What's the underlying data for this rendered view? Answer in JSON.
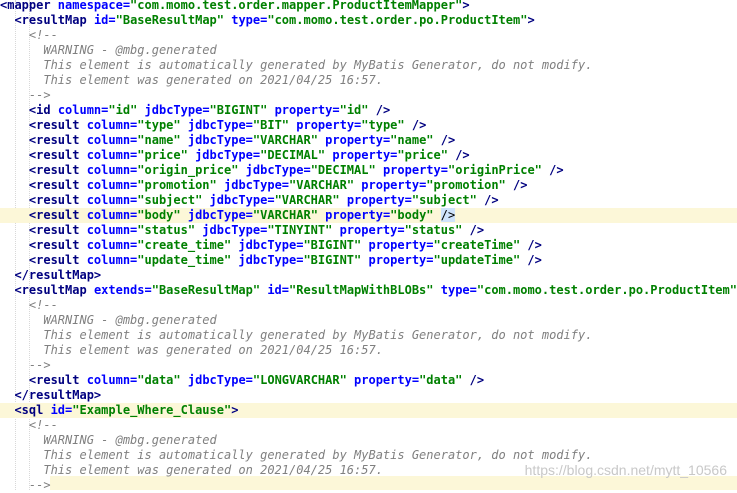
{
  "editor": {
    "lines": [
      {
        "hl": false,
        "tokens": [
          [
            "tag",
            "<mapper "
          ],
          [
            "attr",
            "namespace="
          ],
          [
            "val",
            "\"com.momo.test.order.mapper.ProductItemMapper\""
          ],
          [
            "tag",
            ">"
          ]
        ]
      },
      {
        "hl": false,
        "tokens": [
          [
            "txt",
            "  "
          ],
          [
            "tag",
            "<resultMap "
          ],
          [
            "attr",
            "id="
          ],
          [
            "val",
            "\"BaseResultMap\""
          ],
          [
            "attr",
            " type="
          ],
          [
            "val",
            "\"com.momo.test.order.po.ProductItem\""
          ],
          [
            "tag",
            ">"
          ]
        ]
      },
      {
        "hl": false,
        "tokens": [
          [
            "txt",
            "    "
          ],
          [
            "cm",
            "<!--"
          ]
        ]
      },
      {
        "hl": false,
        "tokens": [
          [
            "txt",
            "      "
          ],
          [
            "cm",
            "WARNING - @mbg.generated"
          ]
        ]
      },
      {
        "hl": false,
        "tokens": [
          [
            "txt",
            "      "
          ],
          [
            "cm",
            "This element is automatically generated by MyBatis Generator, do not modify."
          ]
        ]
      },
      {
        "hl": false,
        "tokens": [
          [
            "txt",
            "      "
          ],
          [
            "cm",
            "This element was generated on 2021/04/25 16:57."
          ]
        ]
      },
      {
        "hl": false,
        "tokens": [
          [
            "txt",
            "    "
          ],
          [
            "cm",
            "-->"
          ]
        ]
      },
      {
        "hl": false,
        "tokens": [
          [
            "txt",
            "    "
          ],
          [
            "tag",
            "<id "
          ],
          [
            "attr",
            "column="
          ],
          [
            "val",
            "\"id\""
          ],
          [
            "attr",
            " jdbcType="
          ],
          [
            "val",
            "\"BIGINT\""
          ],
          [
            "attr",
            " property="
          ],
          [
            "val",
            "\"id\""
          ],
          [
            "tag",
            " />"
          ]
        ]
      },
      {
        "hl": false,
        "tokens": [
          [
            "txt",
            "    "
          ],
          [
            "tag",
            "<result "
          ],
          [
            "attr",
            "column="
          ],
          [
            "val",
            "\"type\""
          ],
          [
            "attr",
            " jdbcType="
          ],
          [
            "val",
            "\"BIT\""
          ],
          [
            "attr",
            " property="
          ],
          [
            "val",
            "\"type\""
          ],
          [
            "tag",
            " />"
          ]
        ]
      },
      {
        "hl": false,
        "tokens": [
          [
            "txt",
            "    "
          ],
          [
            "tag",
            "<result "
          ],
          [
            "attr",
            "column="
          ],
          [
            "val",
            "\"name\""
          ],
          [
            "attr",
            " jdbcType="
          ],
          [
            "val",
            "\"VARCHAR\""
          ],
          [
            "attr",
            " property="
          ],
          [
            "val",
            "\"name\""
          ],
          [
            "tag",
            " />"
          ]
        ]
      },
      {
        "hl": false,
        "tokens": [
          [
            "txt",
            "    "
          ],
          [
            "tag",
            "<result "
          ],
          [
            "attr",
            "column="
          ],
          [
            "val",
            "\"price\""
          ],
          [
            "attr",
            " jdbcType="
          ],
          [
            "val",
            "\"DECIMAL\""
          ],
          [
            "attr",
            " property="
          ],
          [
            "val",
            "\"price\""
          ],
          [
            "tag",
            " />"
          ]
        ]
      },
      {
        "hl": false,
        "tokens": [
          [
            "txt",
            "    "
          ],
          [
            "tag",
            "<result "
          ],
          [
            "attr",
            "column="
          ],
          [
            "val",
            "\"origin_price\""
          ],
          [
            "attr",
            " jdbcType="
          ],
          [
            "val",
            "\"DECIMAL\""
          ],
          [
            "attr",
            " property="
          ],
          [
            "val",
            "\"originPrice\""
          ],
          [
            "tag",
            " />"
          ]
        ]
      },
      {
        "hl": false,
        "tokens": [
          [
            "txt",
            "    "
          ],
          [
            "tag",
            "<result "
          ],
          [
            "attr",
            "column="
          ],
          [
            "val",
            "\"promotion\""
          ],
          [
            "attr",
            " jdbcType="
          ],
          [
            "val",
            "\"VARCHAR\""
          ],
          [
            "attr",
            " property="
          ],
          [
            "val",
            "\"promotion\""
          ],
          [
            "tag",
            " />"
          ]
        ]
      },
      {
        "hl": false,
        "tokens": [
          [
            "txt",
            "    "
          ],
          [
            "tag",
            "<result "
          ],
          [
            "attr",
            "column="
          ],
          [
            "val",
            "\"subject\""
          ],
          [
            "attr",
            " jdbcType="
          ],
          [
            "val",
            "\"VARCHAR\""
          ],
          [
            "attr",
            " property="
          ],
          [
            "val",
            "\"subject\""
          ],
          [
            "tag",
            " />"
          ]
        ]
      },
      {
        "hl": true,
        "tokens": [
          [
            "txt",
            "    "
          ],
          [
            "tag",
            "<result "
          ],
          [
            "attr",
            "column="
          ],
          [
            "val",
            "\"body\""
          ],
          [
            "attr",
            " jdbcType="
          ],
          [
            "val",
            "\"VARCHAR\""
          ],
          [
            "attr",
            " property="
          ],
          [
            "val",
            "\"body\""
          ],
          [
            "tag",
            " "
          ],
          [
            "cur",
            "/>"
          ]
        ]
      },
      {
        "hl": false,
        "tokens": [
          [
            "txt",
            "    "
          ],
          [
            "tag",
            "<result "
          ],
          [
            "attr",
            "column="
          ],
          [
            "val",
            "\"status\""
          ],
          [
            "attr",
            " jdbcType="
          ],
          [
            "val",
            "\"TINYINT\""
          ],
          [
            "attr",
            " property="
          ],
          [
            "val",
            "\"status\""
          ],
          [
            "tag",
            " />"
          ]
        ]
      },
      {
        "hl": false,
        "tokens": [
          [
            "txt",
            "    "
          ],
          [
            "tag",
            "<result "
          ],
          [
            "attr",
            "column="
          ],
          [
            "val",
            "\"create_time\""
          ],
          [
            "attr",
            " jdbcType="
          ],
          [
            "val",
            "\"BIGINT\""
          ],
          [
            "attr",
            " property="
          ],
          [
            "val",
            "\"createTime\""
          ],
          [
            "tag",
            " />"
          ]
        ]
      },
      {
        "hl": false,
        "tokens": [
          [
            "txt",
            "    "
          ],
          [
            "tag",
            "<result "
          ],
          [
            "attr",
            "column="
          ],
          [
            "val",
            "\"update_time\""
          ],
          [
            "attr",
            " jdbcType="
          ],
          [
            "val",
            "\"BIGINT\""
          ],
          [
            "attr",
            " property="
          ],
          [
            "val",
            "\"updateTime\""
          ],
          [
            "tag",
            " />"
          ]
        ]
      },
      {
        "hl": false,
        "tokens": [
          [
            "txt",
            "  "
          ],
          [
            "tag",
            "</resultMap>"
          ]
        ]
      },
      {
        "hl": false,
        "tokens": [
          [
            "txt",
            "  "
          ],
          [
            "tag",
            "<resultMap "
          ],
          [
            "attr",
            "extends="
          ],
          [
            "val",
            "\"BaseResultMap\""
          ],
          [
            "attr",
            " id="
          ],
          [
            "val",
            "\"ResultMapWithBLOBs\""
          ],
          [
            "attr",
            " type="
          ],
          [
            "val",
            "\"com.momo.test.order.po.ProductItem\""
          ],
          [
            "tag",
            ">"
          ]
        ]
      },
      {
        "hl": false,
        "tokens": [
          [
            "txt",
            "    "
          ],
          [
            "cm",
            "<!--"
          ]
        ]
      },
      {
        "hl": false,
        "tokens": [
          [
            "txt",
            "      "
          ],
          [
            "cm",
            "WARNING - @mbg.generated"
          ]
        ]
      },
      {
        "hl": false,
        "tokens": [
          [
            "txt",
            "      "
          ],
          [
            "cm",
            "This element is automatically generated by MyBatis Generator, do not modify."
          ]
        ]
      },
      {
        "hl": false,
        "tokens": [
          [
            "txt",
            "      "
          ],
          [
            "cm",
            "This element was generated on 2021/04/25 16:57."
          ]
        ]
      },
      {
        "hl": false,
        "tokens": [
          [
            "txt",
            "    "
          ],
          [
            "cm",
            "-->"
          ]
        ]
      },
      {
        "hl": false,
        "tokens": [
          [
            "txt",
            "    "
          ],
          [
            "tag",
            "<result "
          ],
          [
            "attr",
            "column="
          ],
          [
            "val",
            "\"data\""
          ],
          [
            "attr",
            " jdbcType="
          ],
          [
            "val",
            "\"LONGVARCHAR\""
          ],
          [
            "attr",
            " property="
          ],
          [
            "val",
            "\"data\""
          ],
          [
            "tag",
            " />"
          ]
        ]
      },
      {
        "hl": false,
        "tokens": [
          [
            "txt",
            "  "
          ],
          [
            "tag",
            "</resultMap>"
          ]
        ]
      },
      {
        "hl": true,
        "tokens": [
          [
            "txt",
            "  "
          ],
          [
            "tag",
            "<sql "
          ],
          [
            "attr",
            "id="
          ],
          [
            "val",
            "\"Example_Where_Clause\""
          ],
          [
            "tag",
            ">"
          ]
        ]
      },
      {
        "hl": false,
        "tokens": [
          [
            "txt",
            "    "
          ],
          [
            "cm",
            "<!--"
          ]
        ]
      },
      {
        "hl": false,
        "tokens": [
          [
            "txt",
            "      "
          ],
          [
            "cm",
            "WARNING - @mbg.generated"
          ]
        ]
      },
      {
        "hl": false,
        "tokens": [
          [
            "txt",
            "      "
          ],
          [
            "cm",
            "This element is automatically generated by MyBatis Generator, do not modify."
          ]
        ]
      },
      {
        "hl": false,
        "tokens": [
          [
            "txt",
            "      "
          ],
          [
            "cm",
            "This element was generated on 2021/04/25 16:57."
          ]
        ]
      },
      {
        "hl": false,
        "tokens": [
          [
            "txt",
            "    "
          ],
          [
            "cm",
            "-->"
          ]
        ]
      }
    ]
  },
  "watermark": "https://blog.csdn.net/mytt_10566"
}
